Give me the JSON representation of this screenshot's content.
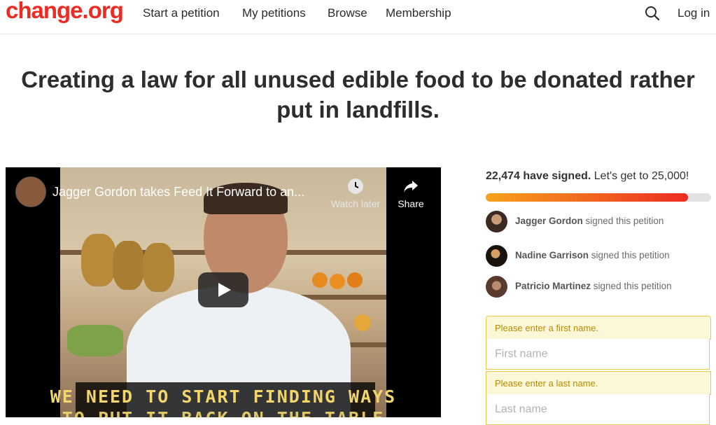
{
  "header": {
    "logo": "change.org",
    "nav": [
      "Start a petition",
      "My petitions",
      "Browse",
      "Membership"
    ],
    "login": "Log in",
    "brand_color": "#ec2c22"
  },
  "petition": {
    "title_line1": "Creating a law for all unused edible food to be donated rather",
    "title_line2": "put in landfills."
  },
  "video": {
    "title": "Jagger Gordon takes Feed It Forward to an...",
    "watch_later": "Watch later",
    "share": "Share",
    "caption_line1": "WE NEED TO START FINDING WAYS",
    "caption_line2": "TO PUT IT BACK ON THE TABLE"
  },
  "signatures": {
    "count": "22,474 have signed.",
    "goal_text": "Let's get to 25,000!",
    "progress_fraction": 0.899,
    "signers": [
      {
        "name": "Jagger Gordon",
        "action": "signed this petition"
      },
      {
        "name": "Nadine Garrison",
        "action": "signed this petition"
      },
      {
        "name": "Patricio Martinez",
        "action": "signed this petition"
      }
    ]
  },
  "form": {
    "first_name_error": "Please enter a first name.",
    "first_name_placeholder": "First name",
    "last_name_error": "Please enter a last name.",
    "last_name_placeholder": "Last name"
  }
}
